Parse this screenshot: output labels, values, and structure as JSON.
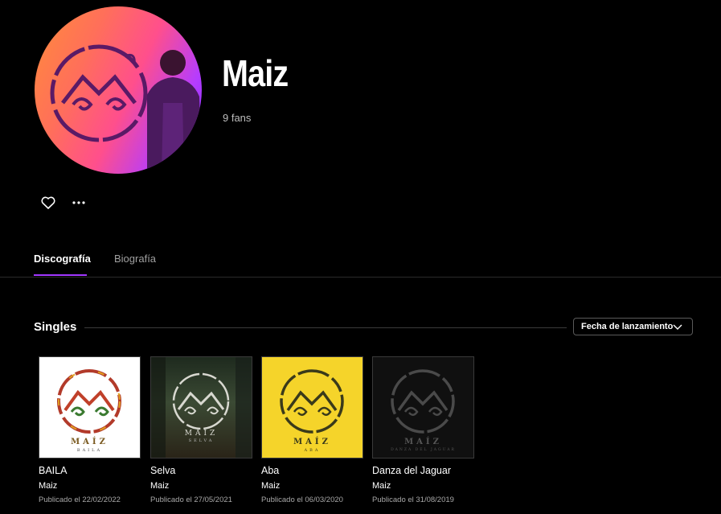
{
  "artist": {
    "name": "Maiz",
    "fans": "9 fans"
  },
  "icons": {
    "like": "heart-icon",
    "more": "more-icon",
    "sort": "chevron-down-icon"
  },
  "tabs": [
    {
      "label": "Discografía",
      "active": true
    },
    {
      "label": "Biografía",
      "active": false
    }
  ],
  "section": {
    "title": "Singles",
    "sort_label": "Fecha de lanzamiento"
  },
  "singles": [
    {
      "title": "BAILA",
      "artist": "Maiz",
      "date": "Publicado el 22/02/2022",
      "cover_word": "MAÍZ",
      "cover_sub": "BAILA",
      "cover_bg": "#ffffff"
    },
    {
      "title": "Selva",
      "artist": "Maiz",
      "date": "Publicado el 27/05/2021",
      "cover_word": "MAÍZ",
      "cover_sub": "SELVA",
      "cover_bg": "#2d3a2a"
    },
    {
      "title": "Aba",
      "artist": "Maiz",
      "date": "Publicado el 06/03/2020",
      "cover_word": "MAÍZ",
      "cover_sub": "ABA",
      "cover_bg": "#f5d42a"
    },
    {
      "title": "Danza del Jaguar",
      "artist": "Maiz",
      "date": "Publicado el 31/08/2019",
      "cover_word": "MAÍZ",
      "cover_sub": "DANZA DEL JAGUAR",
      "cover_bg": "#111111"
    }
  ],
  "colors": {
    "accent": "#a238ff",
    "background": "#000000"
  }
}
